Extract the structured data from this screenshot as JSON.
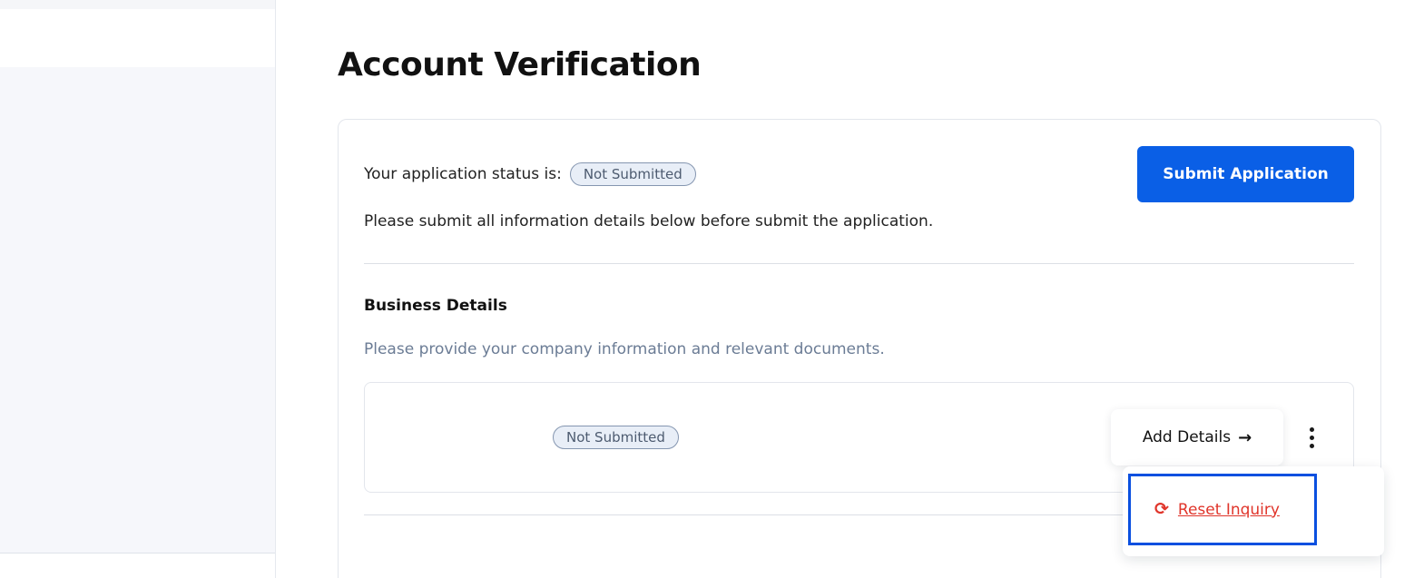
{
  "page": {
    "title": "Account Verification"
  },
  "application": {
    "status_label": "Your application status is:",
    "status_value": "Not Submitted",
    "instructions": "Please submit all information details below before submit the application.",
    "submit_label": "Submit Application"
  },
  "business_details": {
    "title": "Business Details",
    "description": "Please provide your company information and relevant documents.",
    "status_value": "Not Submitted",
    "add_details_label": "Add Details",
    "arrow_glyph": "→"
  },
  "dropdown": {
    "reset_label": "Reset Inquiry",
    "reset_icon_glyph": "⟳"
  },
  "colors": {
    "primary": "#0a5fe6",
    "danger": "#e0352b",
    "badge_bg": "#e8eef7"
  },
  "icons": {
    "arrow": "arrow-right-icon",
    "more": "more-vertical-icon",
    "reset": "refresh-icon"
  }
}
